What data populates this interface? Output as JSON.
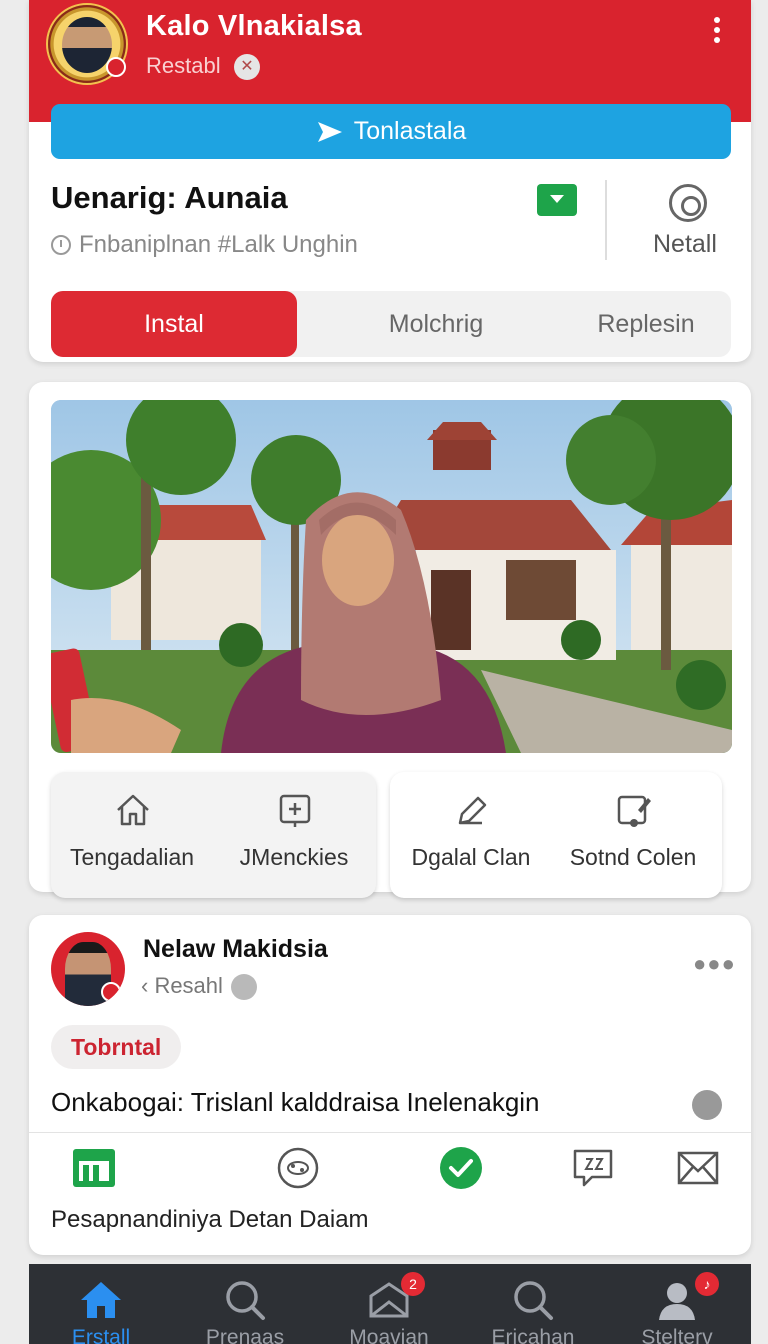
{
  "header": {
    "title": "Kalo Vlnakialsa",
    "subtitle": "Restabl",
    "primary_button": "Tonlastala",
    "info_title": "Uenarig: Aunaia",
    "info_meta": "Fnbaniplnan  #Lalk Unghin",
    "side_label": "Netall"
  },
  "segments": [
    "Instal",
    "Molchrig",
    "Replesin"
  ],
  "tiles": [
    {
      "label": "Tengadalian",
      "icon": "home-outline-icon"
    },
    {
      "label": "JMenckies",
      "icon": "add-box-icon"
    },
    {
      "label": "Dgalal Clan",
      "icon": "pen-icon"
    },
    {
      "label": "Sotnd Colen",
      "icon": "edit-note-icon"
    }
  ],
  "post": {
    "author": "Nelaw Makidsia",
    "sub": "‹ Resahl",
    "pill": "Tobrntal",
    "text": "Onkabogai: Trislanl kalddraisa Inelenakgin",
    "caption": "Pesapnandiniya Detan Daiam"
  },
  "nav": [
    {
      "label": "Erstall",
      "icon": "home-icon",
      "active": true
    },
    {
      "label": "Prenaas",
      "icon": "search-icon"
    },
    {
      "label": "Moavian",
      "icon": "mail-icon",
      "badge": "2"
    },
    {
      "label": "Ericahan",
      "icon": "search-icon"
    },
    {
      "label": "Stelterv",
      "icon": "profile-icon"
    }
  ],
  "colors": {
    "brand_red": "#d9232e",
    "accent_blue": "#1ea3e1",
    "nav_active": "#2b8ff0",
    "success_green": "#1ea44a"
  }
}
